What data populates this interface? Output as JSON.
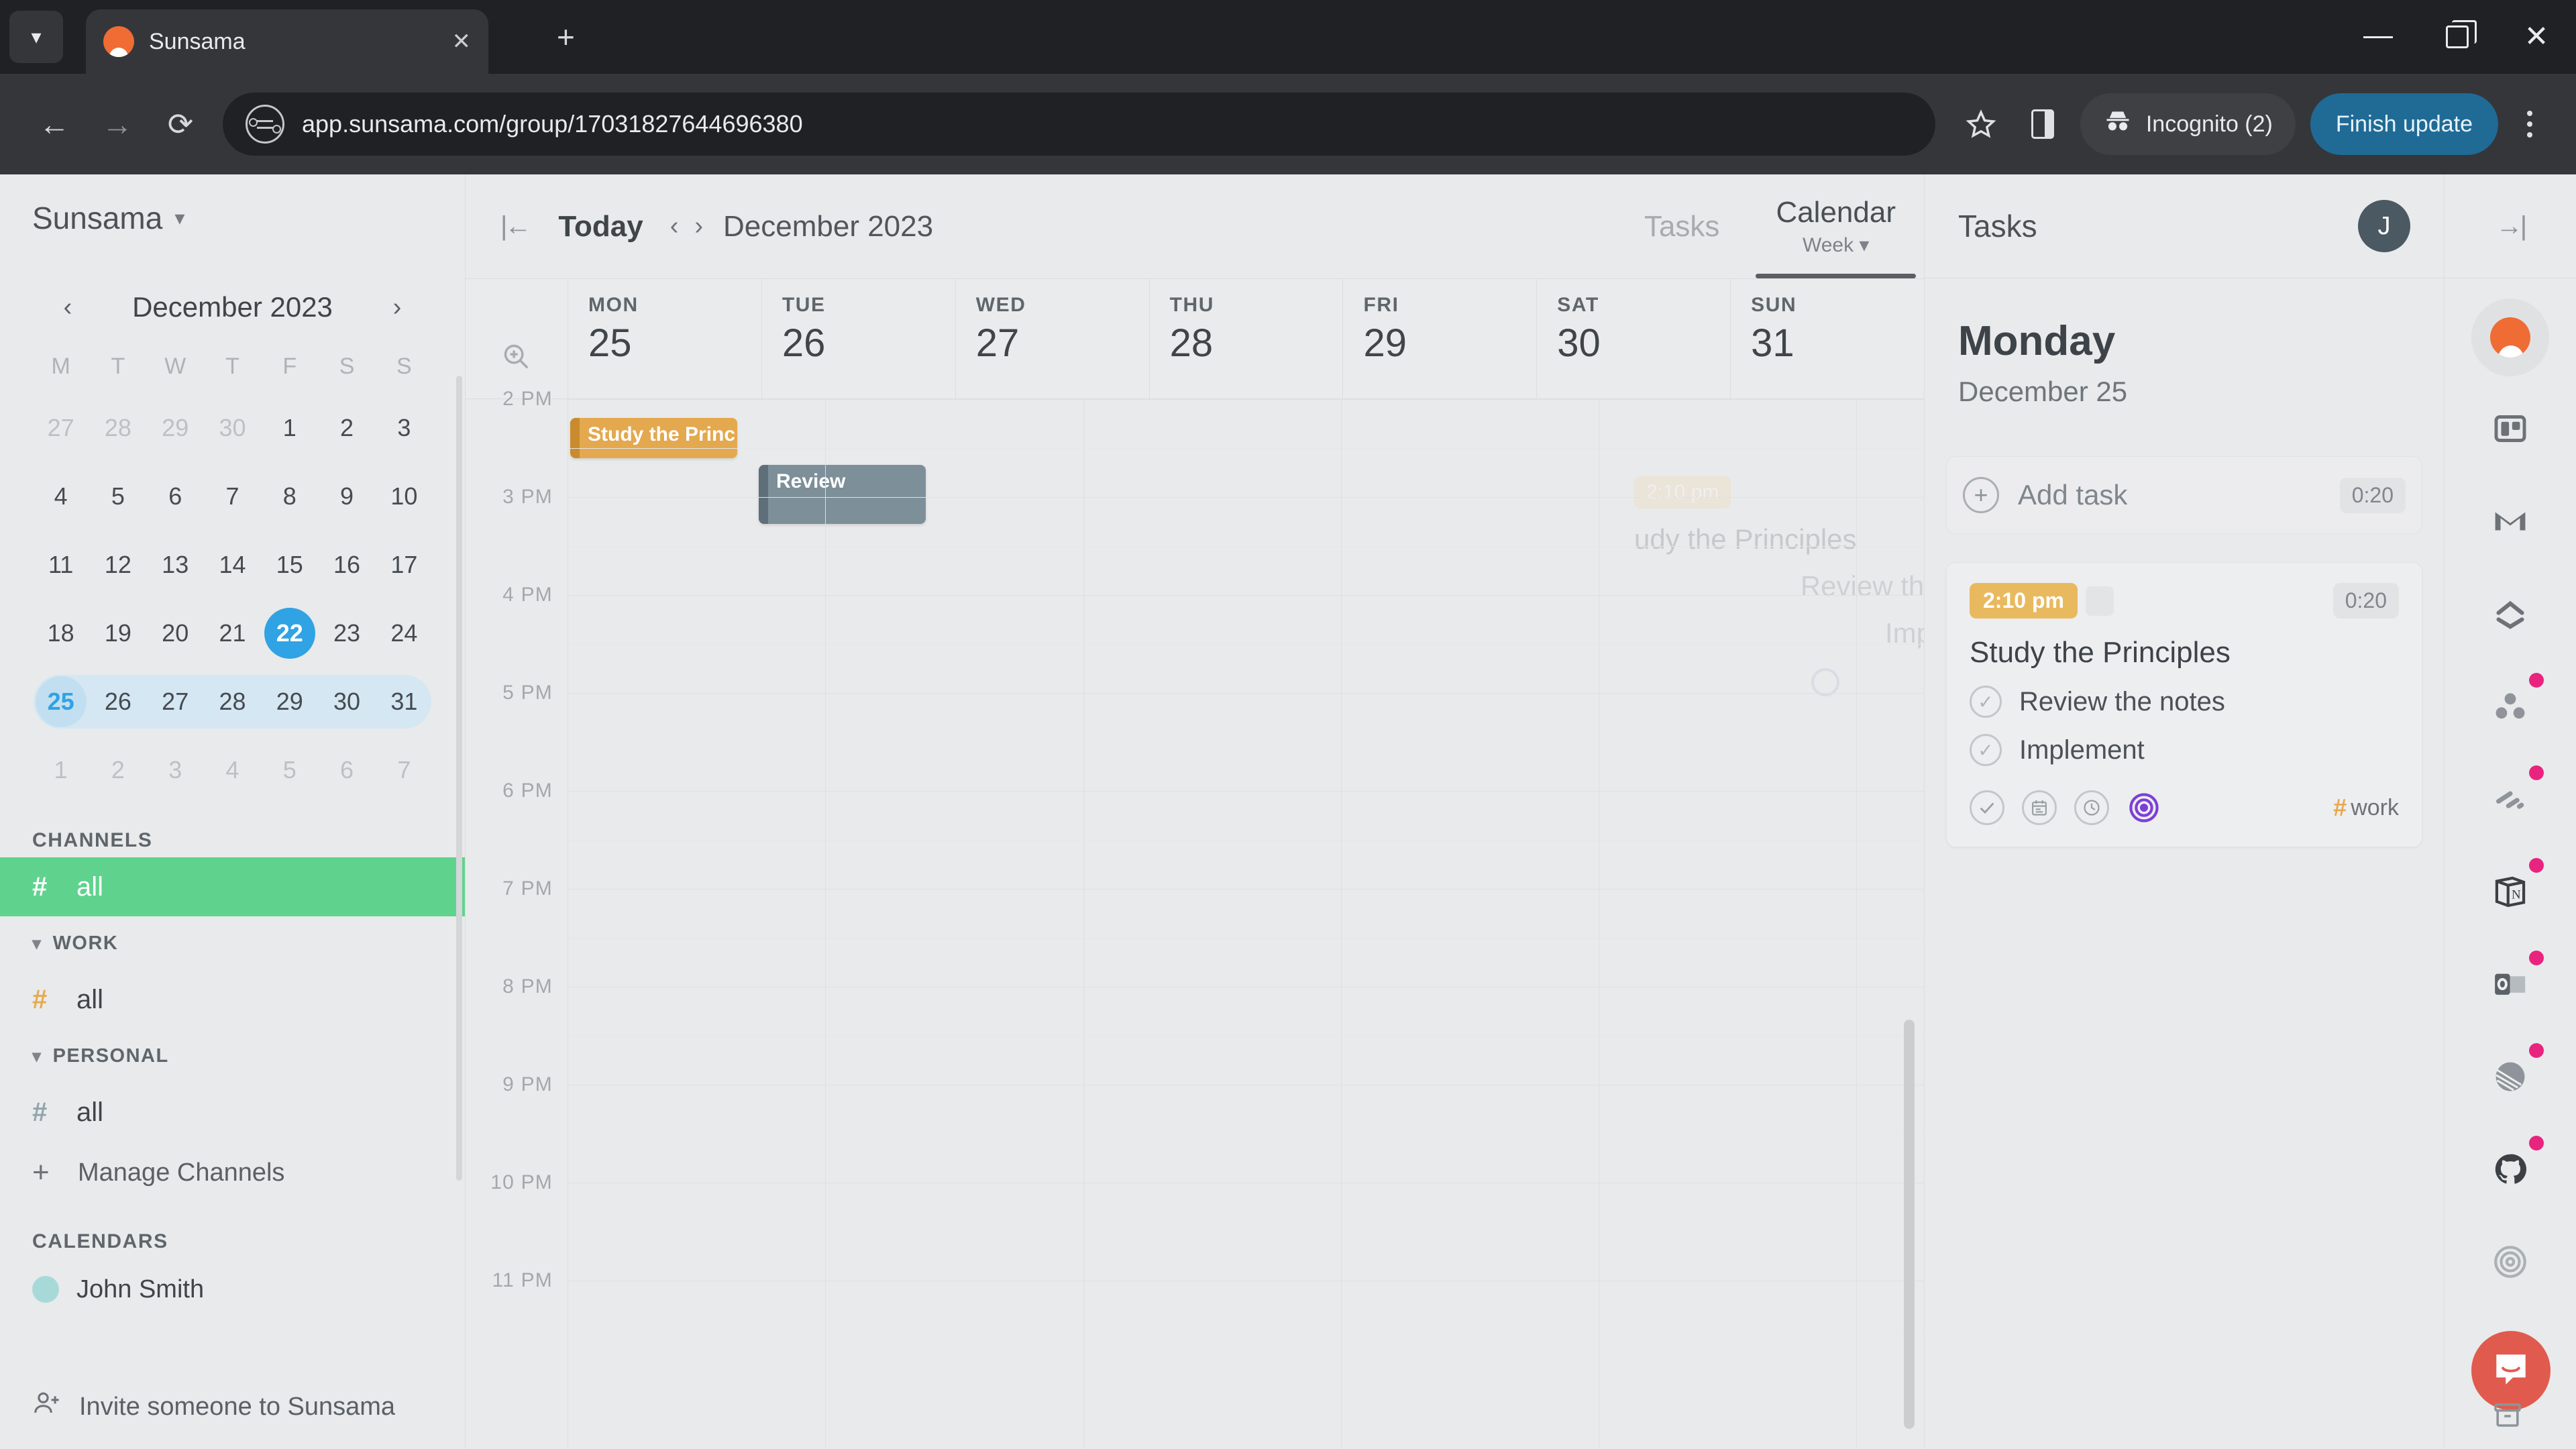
{
  "browser": {
    "tab_title": "Sunsama",
    "tab_close_icon": "close-icon",
    "new_tab_icon": "plus-icon",
    "tabstrip_chevron_icon": "chevron-down-icon",
    "back_icon": "arrow-left-icon",
    "forward_icon": "arrow-right-icon",
    "reload_icon": "reload-icon",
    "site_info_icon": "site-settings-icon",
    "url": "app.sunsama.com/group/17031827644696380",
    "bookmark_icon": "star-icon",
    "side_panel_icon": "side-panel-icon",
    "incognito_label": "Incognito (2)",
    "incognito_icon": "incognito-icon",
    "finish_update_label": "Finish update",
    "menu_icon": "kebab-menu-icon",
    "minimize_icon": "minimize-icon",
    "maximize_icon": "maximize-icon",
    "close_icon": "window-close-icon"
  },
  "sidebar": {
    "workspace_name": "Sunsama",
    "workspace_caret_icon": "chevron-down-icon",
    "minicalendar": {
      "prev_icon": "chevron-left-icon",
      "next_icon": "chevron-right-icon",
      "title": "December 2023",
      "dow": [
        "M",
        "T",
        "W",
        "T",
        "F",
        "S",
        "S"
      ],
      "weeks": [
        [
          {
            "d": "27",
            "out": true
          },
          {
            "d": "28",
            "out": true
          },
          {
            "d": "29",
            "out": true
          },
          {
            "d": "30",
            "out": true
          },
          {
            "d": "1"
          },
          {
            "d": "2"
          },
          {
            "d": "3"
          }
        ],
        [
          {
            "d": "4"
          },
          {
            "d": "5"
          },
          {
            "d": "6"
          },
          {
            "d": "7"
          },
          {
            "d": "8"
          },
          {
            "d": "9"
          },
          {
            "d": "10"
          }
        ],
        [
          {
            "d": "11"
          },
          {
            "d": "12"
          },
          {
            "d": "13"
          },
          {
            "d": "14"
          },
          {
            "d": "15"
          },
          {
            "d": "16"
          },
          {
            "d": "17"
          }
        ],
        [
          {
            "d": "18"
          },
          {
            "d": "19"
          },
          {
            "d": "20"
          },
          {
            "d": "21"
          },
          {
            "d": "22",
            "today": true
          },
          {
            "d": "23"
          },
          {
            "d": "24"
          }
        ],
        [
          {
            "d": "25",
            "weekstart": true
          },
          {
            "d": "26"
          },
          {
            "d": "27"
          },
          {
            "d": "28"
          },
          {
            "d": "29"
          },
          {
            "d": "30"
          },
          {
            "d": "31"
          }
        ],
        [
          {
            "d": "1",
            "out": true
          },
          {
            "d": "2",
            "out": true
          },
          {
            "d": "3",
            "out": true
          },
          {
            "d": "4",
            "out": true
          },
          {
            "d": "5",
            "out": true
          },
          {
            "d": "6",
            "out": true
          },
          {
            "d": "7",
            "out": true
          }
        ]
      ],
      "selected_day": "22",
      "selected_week_start": "25"
    },
    "channels_label": "CHANNELS",
    "channel_all": "all",
    "work_group_label": "WORK",
    "work_channel": "all",
    "personal_group_label": "PERSONAL",
    "personal_channel": "all",
    "manage_channels_label": "Manage Channels",
    "calendars_label": "CALENDARS",
    "calendar_person": "John Smith",
    "invite_label": "Invite someone to Sunsama",
    "accent_green": "#5fd38d",
    "accent_orange": "#e8a84c",
    "accent_blue": "#2fa3e3"
  },
  "calendar": {
    "collapse_icon": "collapse-left-icon",
    "today_label": "Today",
    "prev_icon": "chevron-left-icon",
    "next_icon": "chevron-right-icon",
    "month_label": "December 2023",
    "tabs": [
      {
        "label": "Tasks",
        "sub": "",
        "active": false
      },
      {
        "label": "Calendar",
        "sub": "Week",
        "active": true
      }
    ],
    "view_caret_icon": "chevron-down-icon",
    "zoom_icon": "zoom-in-icon",
    "days": [
      {
        "dow": "MON",
        "num": "25"
      },
      {
        "dow": "TUE",
        "num": "26"
      },
      {
        "dow": "WED",
        "num": "27"
      },
      {
        "dow": "THU",
        "num": "28"
      },
      {
        "dow": "FRI",
        "num": "29"
      },
      {
        "dow": "SAT",
        "num": "30"
      },
      {
        "dow": "SUN",
        "num": "31"
      }
    ],
    "time_labels": [
      "2 PM",
      "3 PM",
      "4 PM",
      "5 PM",
      "6 PM",
      "7 PM",
      "8 PM",
      "9 PM",
      "10 PM",
      "11 PM"
    ],
    "events": [
      {
        "title": "Study the Princ",
        "day": 0,
        "color": "#e4a84e",
        "accent": "#c98b2d"
      },
      {
        "title": "Review",
        "day": 1,
        "color": "#7d8f99",
        "accent": "#5e6f79"
      }
    ],
    "drag_ghost": {
      "chip": "2:10 pm",
      "title": "udy the Principles",
      "sub1": "Review the notes",
      "sub2": "Implement"
    }
  },
  "tasks_panel": {
    "title": "Tasks",
    "avatar_initial": "J",
    "day_name": "Monday",
    "date_sub": "December 25",
    "add_task_label": "Add task",
    "add_task_plus_icon": "plus-circle-icon",
    "add_task_duration": "0:20",
    "card": {
      "time_chip": "2:10 pm",
      "duration": "0:20",
      "title": "Study the Principles",
      "subtasks": [
        {
          "label": "Review the notes",
          "check_icon": "check-circle-icon"
        },
        {
          "label": "Implement",
          "check_icon": "check-circle-icon"
        }
      ],
      "footer_icons": [
        "check-circle-icon",
        "calendar-icon",
        "clock-icon",
        "target-icon"
      ],
      "tag_hash": "#",
      "tag_label": "work"
    }
  },
  "rail": {
    "collapse_icon": "collapse-right-icon",
    "items": [
      {
        "name": "sunsama-logo-icon",
        "badge": false,
        "selected": true
      },
      {
        "name": "trello-icon",
        "badge": false,
        "selected": false
      },
      {
        "name": "gmail-icon",
        "badge": false,
        "selected": false
      },
      {
        "name": "clickup-icon",
        "badge": false,
        "selected": false
      },
      {
        "name": "asana-icon",
        "badge": true,
        "selected": false
      },
      {
        "name": "todoist-icon",
        "badge": true,
        "selected": false
      },
      {
        "name": "notion-icon",
        "badge": true,
        "selected": false
      },
      {
        "name": "outlook-icon",
        "badge": true,
        "selected": false
      },
      {
        "name": "linear-icon",
        "badge": true,
        "selected": false
      },
      {
        "name": "github-icon",
        "badge": true,
        "selected": false
      },
      {
        "name": "target-icon",
        "badge": false,
        "selected": false
      }
    ],
    "badge_color": "#e8247f",
    "intercom_icon": "intercom-chat-icon",
    "intercom_color": "#e05b4e"
  }
}
